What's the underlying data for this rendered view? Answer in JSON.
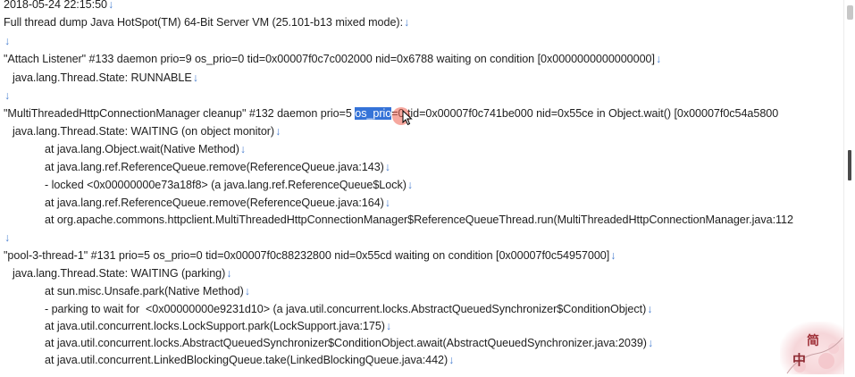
{
  "editor": {
    "lines": [
      {
        "text": "2018-05-24 22:15:50",
        "mark": "↓"
      },
      {
        "text": "Full thread dump Java HotSpot(TM) 64-Bit Server VM (25.101-b13 mixed mode):",
        "mark": "↓"
      },
      {
        "text": "",
        "mark": "↓"
      },
      {
        "text": "\"Attach Listener\" #133 daemon prio=9 os_prio=0 tid=0x00007f0c7c002000 nid=0x6788 waiting on condition [0x0000000000000000]",
        "mark": "↓"
      },
      {
        "text": "java.lang.Thread.State: RUNNABLE",
        "mark": "↓"
      },
      {
        "text": "",
        "mark": "↓"
      },
      {
        "pre": "\"MultiThreadedHttpConnectionManager cleanup\" #132 daemon prio=5 ",
        "selected": "os_prio",
        "post": "=0 tid=0x00007f0c741be000 nid=0x55ce in Object.wait() [0x00007f0c54a5800"
      },
      {
        "text": "java.lang.Thread.State: WAITING (on object monitor)",
        "mark": "↓"
      },
      {
        "text": "at java.lang.Object.wait(Native Method)",
        "mark": "↓"
      },
      {
        "text": "at java.lang.ref.ReferenceQueue.remove(ReferenceQueue.java:143)",
        "mark": "↓"
      },
      {
        "text": "- locked <0x00000000e73a18f8> (a java.lang.ref.ReferenceQueue$Lock)",
        "mark": "↓"
      },
      {
        "text": "at java.lang.ref.ReferenceQueue.remove(ReferenceQueue.java:164)",
        "mark": "↓"
      },
      {
        "text": "at org.apache.commons.httpclient.MultiThreadedHttpConnectionManager$ReferenceQueueThread.run(MultiThreadedHttpConnectionManager.java:112",
        "mark": ""
      },
      {
        "text": "",
        "mark": "↓"
      },
      {
        "text": "\"pool-3-thread-1\" #131 prio=5 os_prio=0 tid=0x00007f0c88232800 nid=0x55cd waiting on condition [0x00007f0c54957000]",
        "mark": "↓"
      },
      {
        "text": "java.lang.Thread.State: WAITING (parking)",
        "mark": "↓"
      },
      {
        "text": "at sun.misc.Unsafe.park(Native Method)",
        "mark": "↓"
      },
      {
        "text": "- parking to wait for  <0x00000000e9231d10> (a java.util.concurrent.locks.AbstractQueuedSynchronizer$ConditionObject)",
        "mark": "↓"
      },
      {
        "text": "at java.util.concurrent.locks.LockSupport.park(LockSupport.java:175)",
        "mark": "↓"
      },
      {
        "text": "at java.util.concurrent.locks.AbstractQueuedSynchronizer$ConditionObject.await(AbstractQueuedSynchronizer.java:2039)",
        "mark": "↓"
      },
      {
        "text": "at java.util.concurrent.LinkedBlockingQueue.take(LinkedBlockingQueue.java:442)",
        "mark": "↓"
      }
    ]
  },
  "watermark": {
    "chars": [
      "简",
      "中"
    ]
  },
  "colors": {
    "selection": "#3573d8",
    "mark": "#4a7fd0",
    "text": "#1e1e1e",
    "click_marker": "#ee6050"
  },
  "icons": {
    "cursor": "mouse-pointer-icon",
    "click": "click-highlight-icon",
    "logo": "chinese-logo-stamp"
  }
}
